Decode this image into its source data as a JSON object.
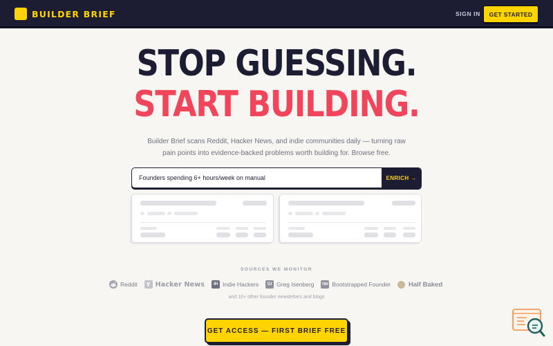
{
  "header": {
    "brand": "BUILDER BRIEF",
    "logo_icon": "lightning-bolt-icon",
    "signin_label": "SIGN IN",
    "get_started_label": "GET STARTED",
    "colors": {
      "bar": "#1c1d33",
      "accent": "#ffd400"
    }
  },
  "hero": {
    "line1": "STOP GUESSING.",
    "line2": "START BUILDING.",
    "line2_color": "#f0455a",
    "subtitle": "Builder Brief scans Reddit, Hacker News, and indie communities daily — turning raw pain points into evidence-backed problems worth building for. Browse free."
  },
  "search": {
    "value": "Founders spending 6+ hours/week on manual",
    "button_label": "ENRICH →"
  },
  "sources": {
    "label": "SOURCES WE MONITOR",
    "items": [
      {
        "name": "Reddit",
        "icon": "reddit-icon"
      },
      {
        "name": "Hacker News",
        "icon": "y-combinator-icon",
        "icon_text": "Y"
      },
      {
        "name": "Indie Hackers",
        "icon": "indie-hackers-icon",
        "icon_text": "IH"
      },
      {
        "name": "Greg Isenberg",
        "icon": "greg-isenberg-icon",
        "icon_text": "GI"
      },
      {
        "name": "Bootstrapped Founder",
        "icon": "bootstrapped-founder-icon",
        "icon_text": "TBF"
      },
      {
        "name": "Half Baked",
        "icon": "half-baked-icon"
      }
    ],
    "others": "and 10+ other founder newsletters and blogs"
  },
  "cta": {
    "label": "GET ACCESS — FIRST BRIEF FREE"
  },
  "widget": {
    "icon": "search-chat-icon"
  }
}
